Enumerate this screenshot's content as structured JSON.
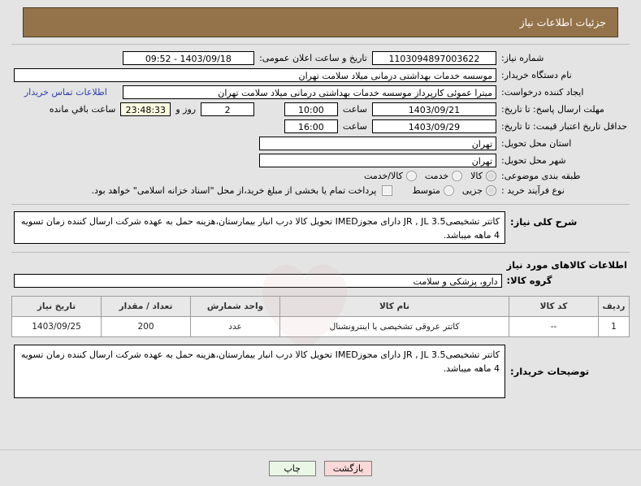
{
  "header": {
    "title": "جزئیات اطلاعات نیاز"
  },
  "form": {
    "need_number_label": "شماره نیاز:",
    "need_number_value": "1103094897003622",
    "public_announce_label": "تاریخ و ساعت اعلان عمومی:",
    "public_announce_value": "09:52 - 1403/09/18",
    "buyer_org_label": "نام دستگاه خریدار:",
    "buyer_org_value": "موسسه خدمات بهداشتی درمانی میلاد سلامت تهران",
    "requester_label": "ایجاد کننده درخواست:",
    "requester_value": "میترا عموئی کارپرداز موسسه خدمات بهداشتی درمانی میلاد سلامت تهران",
    "contact_link": "اطلاعات تماس خریدار",
    "reply_deadline_label": "مهلت ارسال پاسخ: تا تاریخ:",
    "reply_deadline_date": "1403/09/21",
    "hour_label": "ساعت",
    "reply_deadline_time": "10:00",
    "remaining_days": "2",
    "remaining_days_sep": "روز و",
    "remaining_clock": "23:48:33",
    "remaining_suffix": "ساعت باقي مانده",
    "price_validity_label": "حداقل تاریخ اعتبار قیمت: تا تاریخ:",
    "price_validity_date": "1403/09/29",
    "price_validity_time": "16:00",
    "province_label": "استان محل تحویل:",
    "province_value": "تهران",
    "city_label": "شهر محل تحویل:",
    "city_value": "تهران",
    "category_label": "طبقه بندی موضوعی:",
    "category_options": [
      {
        "label": "کالا",
        "selected": true
      },
      {
        "label": "خدمت",
        "selected": false
      },
      {
        "label": "کالا/خدمت",
        "selected": false
      }
    ],
    "process_type_label": "نوع فرآیند خرید :",
    "process_type_options": [
      {
        "label": "جزیی",
        "selected": true
      },
      {
        "label": "متوسط",
        "selected": false
      }
    ],
    "treasury_checkbox_label": "پرداخت تمام یا بخشی از مبلغ خرید،از محل \"اسناد خزانه اسلامی\" خواهد بود.",
    "treasury_checked": false,
    "need_description_label": "شرح کلی نیاز:",
    "need_description_value": "کاتتر تشخیصی3.5  JR , JL دارای مجوزIMED تحویل کالا درب انبار بیمارستان،هزینه حمل به عهده شرکت ارسال کننده زمان تسویه 4 ماهه میباشد.",
    "goods_section_title": "اطلاعات کالاهای مورد نیاز",
    "goods_group_label": "گروه کالا:",
    "goods_group_value": "دارو، پزشکی و سلامت",
    "buyer_notes_label": "توضیحات خریدار:",
    "buyer_notes_value": "کاتتر تشخیصی3.5  JR , JL دارای مجوزIMED تحویل کالا درب انبار بیمارستان،هزینه حمل به عهده شرکت ارسال کننده زمان تسویه 4 ماهه میباشد."
  },
  "table": {
    "headers": [
      "ردیف",
      "کد کالا",
      "نام کالا",
      "واحد شمارش",
      "تعداد / مقدار",
      "تاریخ نیاز"
    ],
    "rows": [
      {
        "row": "1",
        "code": "--",
        "name": "کاتتر عروقی تشخیصی یا اینترونشنال",
        "unit": "عدد",
        "quantity": "200",
        "need_date": "1403/09/25"
      }
    ]
  },
  "footer": {
    "print_label": "چاپ",
    "back_label": "بازگشت"
  },
  "colors": {
    "header_bg": "#94734a",
    "header_text": "#ffffff",
    "link": "#2b3fa8",
    "print_bg": "#eaf7e6",
    "back_bg": "#fbd9d9",
    "countdown_bg": "#fbfbe2"
  }
}
